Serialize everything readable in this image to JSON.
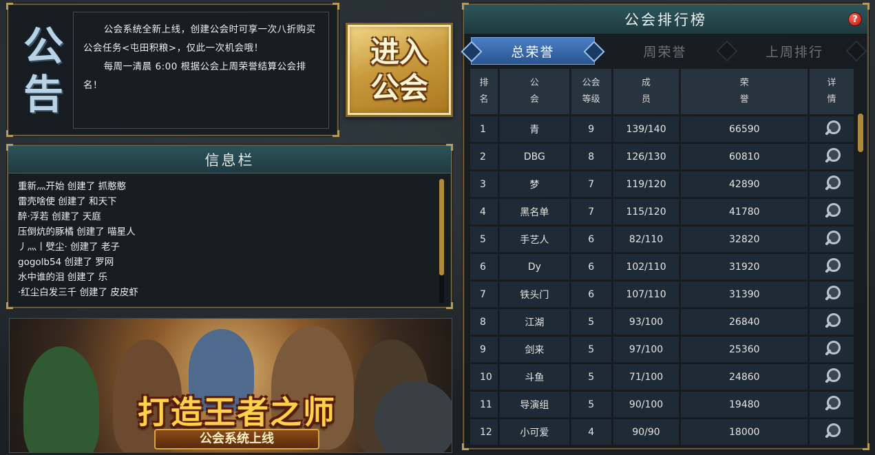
{
  "notice": {
    "title_char1": "公",
    "title_char2": "告",
    "paragraph1": "公会系统全新上线，创建公会时可享一次八折购买公会任务<屯田积粮>，仅此一次机会哦！",
    "paragraph2": "每周一清晨 6:00 根据公会上周荣誉结算公会排名！"
  },
  "enter_button": {
    "line1": "进入",
    "line2": "公会"
  },
  "info": {
    "title": "信息栏",
    "items": [
      "重新灬开始 创建了 抓憨憨",
      "雷壳啥使 创建了 和天下",
      "醉·浮若 创建了 天庭",
      "压倒炕的豚橘 创建了 喵星人",
      "丿灬丨䢃尘· 创建了 老子",
      "gogolb54 创建了 罗网",
      "水中谁的泪 创建了 乐",
      "·红尘白发三千 创建了 皮皮虾"
    ]
  },
  "banner": {
    "title": "打造王者之师",
    "subtitle": "公会系统上线"
  },
  "ranking": {
    "title": "公会排行榜",
    "help_label": "?",
    "tabs": [
      "总荣誉",
      "周荣誉",
      "上周排行"
    ],
    "headers": {
      "rank_a": "排",
      "rank_b": "名",
      "guild_a": "公",
      "guild_b": "会",
      "level_a": "公会",
      "level_b": "等级",
      "members_a": "成",
      "members_b": "员",
      "honor_a": "荣",
      "honor_b": "誉",
      "detail_a": "详",
      "detail_b": "情"
    },
    "rows": [
      {
        "rank": "1",
        "guild": "青",
        "level": "9",
        "members": "139/140",
        "honor": "66590"
      },
      {
        "rank": "2",
        "guild": "DBG",
        "level": "8",
        "members": "126/130",
        "honor": "60810"
      },
      {
        "rank": "3",
        "guild": "梦",
        "level": "7",
        "members": "119/120",
        "honor": "42890"
      },
      {
        "rank": "4",
        "guild": "黑名单",
        "level": "7",
        "members": "115/120",
        "honor": "41780"
      },
      {
        "rank": "5",
        "guild": "手艺人",
        "level": "6",
        "members": "82/110",
        "honor": "32820"
      },
      {
        "rank": "6",
        "guild": "Dy",
        "level": "6",
        "members": "102/110",
        "honor": "31920"
      },
      {
        "rank": "7",
        "guild": "铁头门",
        "level": "6",
        "members": "107/110",
        "honor": "31390"
      },
      {
        "rank": "8",
        "guild": "江湖",
        "level": "5",
        "members": "93/100",
        "honor": "26840"
      },
      {
        "rank": "9",
        "guild": "剑来",
        "level": "5",
        "members": "97/100",
        "honor": "25360"
      },
      {
        "rank": "10",
        "guild": "斗鱼",
        "level": "5",
        "members": "71/100",
        "honor": "24860"
      },
      {
        "rank": "11",
        "guild": "导演组",
        "level": "5",
        "members": "90/100",
        "honor": "19480"
      },
      {
        "rank": "12",
        "guild": "小可爱",
        "level": "4",
        "members": "90/90",
        "honor": "18000"
      }
    ]
  }
}
